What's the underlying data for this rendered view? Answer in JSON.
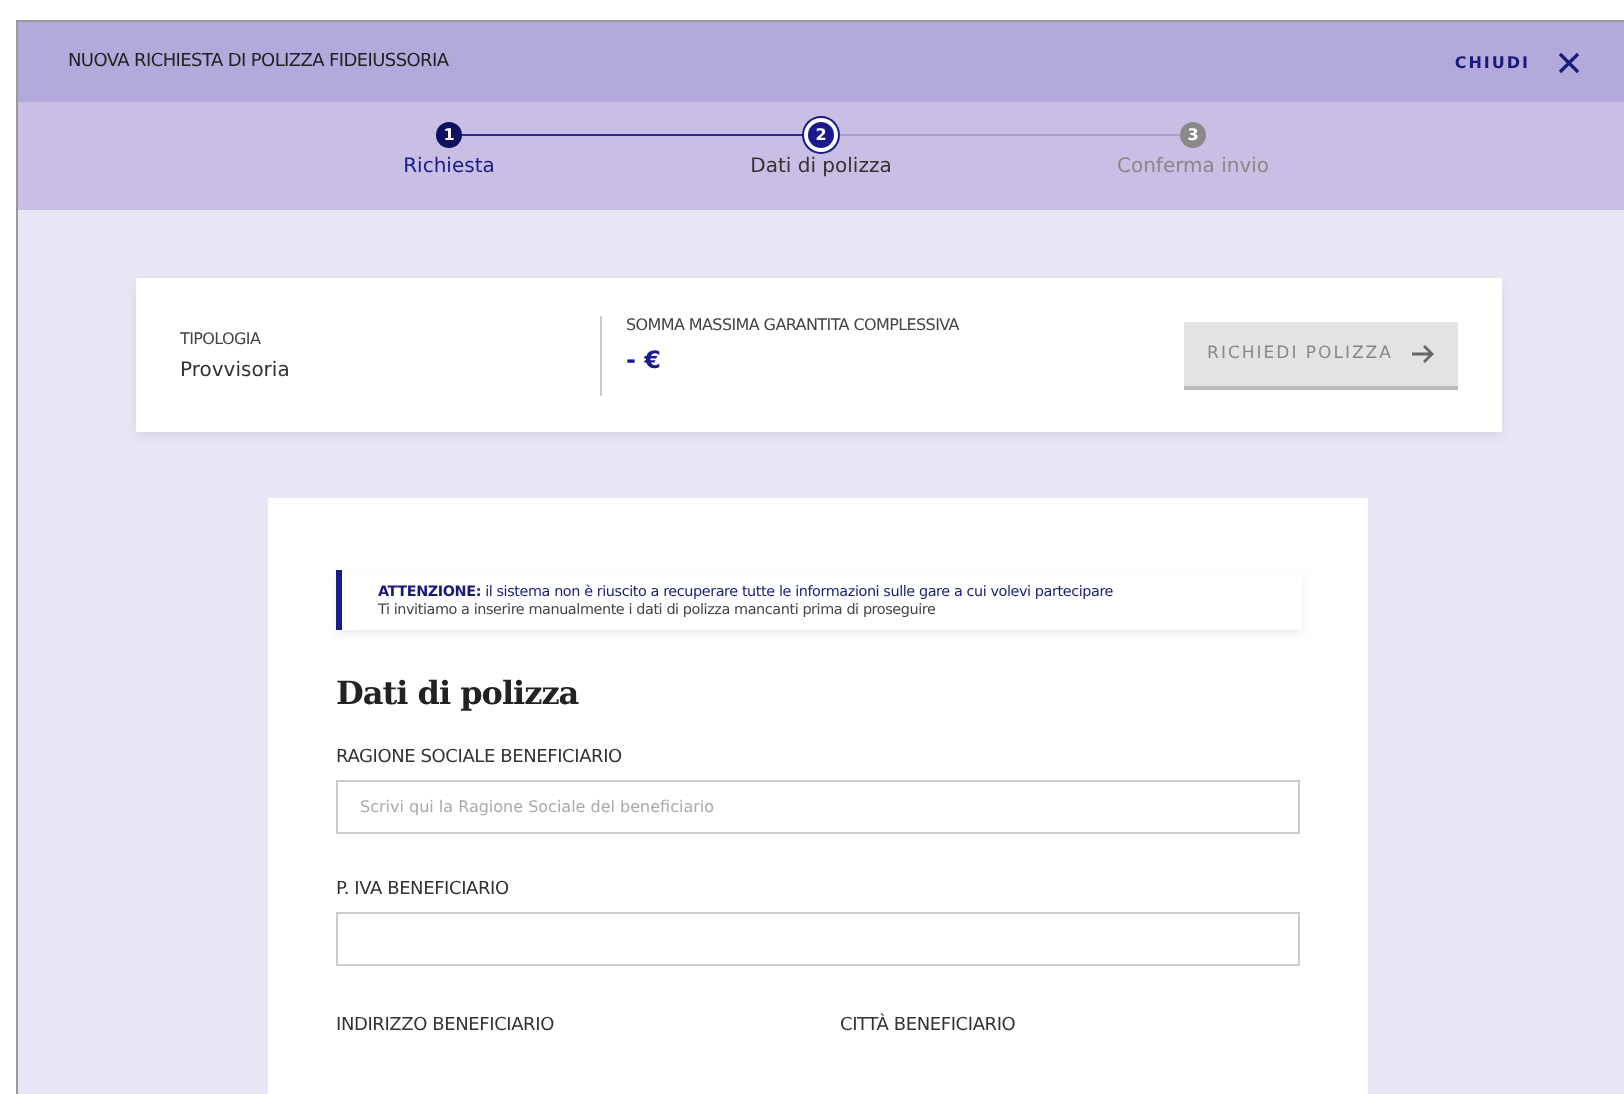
{
  "header": {
    "title": "NUOVA RICHIESTA DI POLIZZA FIDEIUSSORIA",
    "close_label": "CHIUDI"
  },
  "steps": [
    {
      "number": "1",
      "label": "Richiesta",
      "completed": true,
      "selected": false
    },
    {
      "number": "2",
      "label": "Dati di polizza",
      "completed": false,
      "selected": true
    },
    {
      "number": "3",
      "label": "Conferma invio",
      "completed": false,
      "selected": false
    }
  ],
  "summary": {
    "type_label": "TIPOLOGIA",
    "type_value": "Provvisoria",
    "amount_label": "SOMMA MASSIMA GARANTITA COMPLESSIVA",
    "amount_value": "- €",
    "button": {
      "label": "RICHIEDI POLIZZA",
      "disabled": true
    }
  },
  "alert": {
    "message": "**ATTENZIONE:** il sistema non è riuscito a recuperare tutte le informazioni sulle gare a cui volevi partecipare",
    "detail": "Ti invitiamo a inserire manualmente i dati di polizza mancanti prima di proseguire"
  },
  "form": {
    "title": "Dati di polizza",
    "fields": [
      {
        "label": "RAGIONE SOCIALE BENEFICIARIO",
        "placeholder": "Scrivi qui la Ragione Sociale del beneficiario"
      },
      {
        "label": "P. IVA BENEFICIARIO"
      }
    ],
    "partial_labels": [
      "INDIRIZZO BENEFICIARIO",
      "CITTÀ BENEFICIARIO"
    ]
  }
}
